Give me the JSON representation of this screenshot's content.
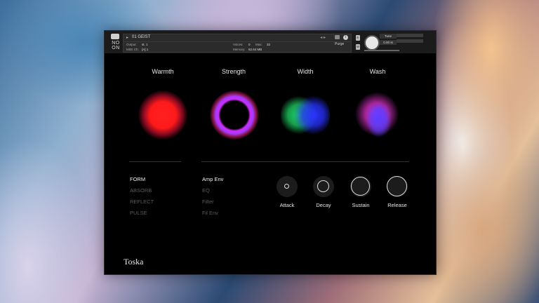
{
  "header": {
    "logo_text_top": "NO",
    "logo_text_bottom": "ON",
    "instrument_name": "01 GEIST",
    "output_label": "Output:",
    "output_value": "st. 1",
    "midi_label": "MIDI Ch:",
    "midi_value": "[A] 1",
    "voices_label": "Voices:",
    "voices_value": "0",
    "max_label": "Max:",
    "max_value": "32",
    "memory_label": "Memory:",
    "memory_value": "62.64 MB",
    "purge_label": "Purge",
    "tune_label": "Tune",
    "tune_value": "0.00",
    "tune_unit": "st",
    "solo_label": "S",
    "mute_label": "M"
  },
  "macros": [
    {
      "label": "Warmth"
    },
    {
      "label": "Strength"
    },
    {
      "label": "Width"
    },
    {
      "label": "Wash"
    }
  ],
  "left_menu": [
    {
      "label": "FORM",
      "active": true
    },
    {
      "label": "ABSORB",
      "active": false
    },
    {
      "label": "REFLECT",
      "active": false
    },
    {
      "label": "PULSE",
      "active": false
    }
  ],
  "mid_menu": [
    {
      "label": "Amp Env",
      "active": true
    },
    {
      "label": "EQ",
      "active": false
    },
    {
      "label": "Filter",
      "active": false
    },
    {
      "label": "Fil Env",
      "active": false
    }
  ],
  "envelope": [
    {
      "label": "Attack",
      "level": 0.15
    },
    {
      "label": "Decay",
      "level": 0.55
    },
    {
      "label": "Sustain",
      "level": 0.9
    },
    {
      "label": "Release",
      "level": 0.95
    }
  ],
  "brand": "Toska",
  "colors": {
    "warmth": "#ff1a1a",
    "strength_ring": "#c236ff",
    "width_left": "#22d36a",
    "width_right": "#2a35ff",
    "wash": "#a43cff",
    "menu_active": "#f2f2f2",
    "menu_inactive": "#5a5a5a"
  }
}
